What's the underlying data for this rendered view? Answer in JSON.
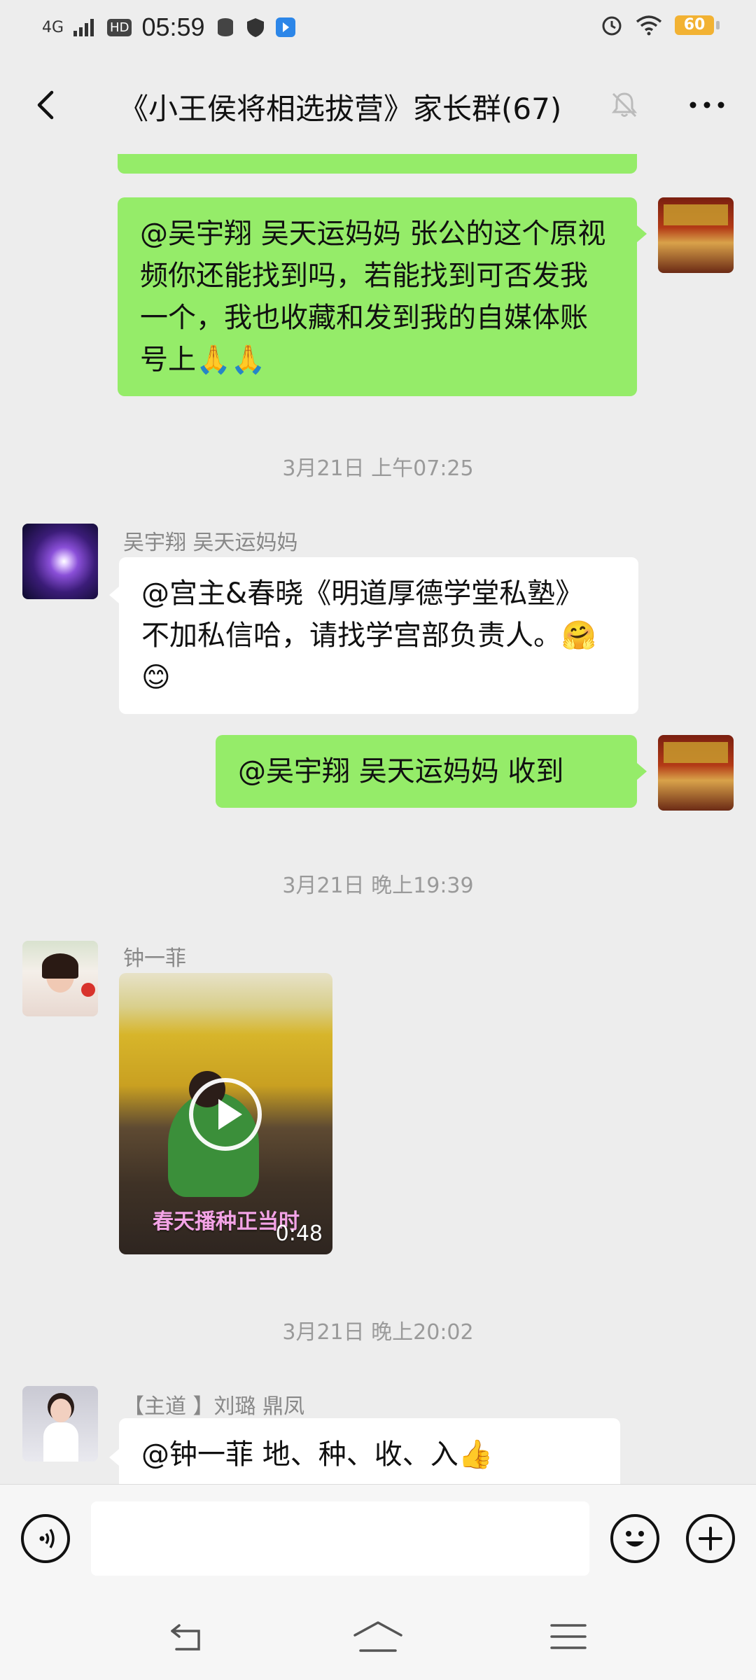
{
  "status_bar": {
    "network": "4G",
    "hd": "HD",
    "time": "05:59",
    "battery": "60"
  },
  "header": {
    "title": "《小王侯将相选拔营》家长群(67)"
  },
  "messages": [
    {
      "type": "outgoing",
      "text": "@吴宇翔 吴天运妈妈  张公的这个原视频你还能找到吗，若能找到可否发我一个，我也收藏和发到我的自媒体账号上🙏🙏"
    },
    {
      "type": "timestamp",
      "text": "3月21日 上午07:25"
    },
    {
      "type": "incoming",
      "sender": "吴宇翔 吴天运妈妈",
      "text": "@宫主&春晓《明道厚德学堂私塾》 不加私信哈，请找学宫部负责人。🤗😊"
    },
    {
      "type": "outgoing",
      "text": "@吴宇翔 吴天运妈妈  收到"
    },
    {
      "type": "timestamp",
      "text": "3月21日 晚上19:39"
    },
    {
      "type": "incoming-video",
      "sender": "钟一菲",
      "caption": "春天播种正当时",
      "duration": "0:48"
    },
    {
      "type": "timestamp",
      "text": "3月21日 晚上20:02"
    },
    {
      "type": "incoming",
      "sender": "【主道 】刘璐 鼎凤",
      "text": "@钟一菲       地、种、收、入👍"
    }
  ],
  "colors": {
    "outgoing_bubble": "#95ec69",
    "incoming_bubble": "#ffffff",
    "background": "#ededed"
  }
}
